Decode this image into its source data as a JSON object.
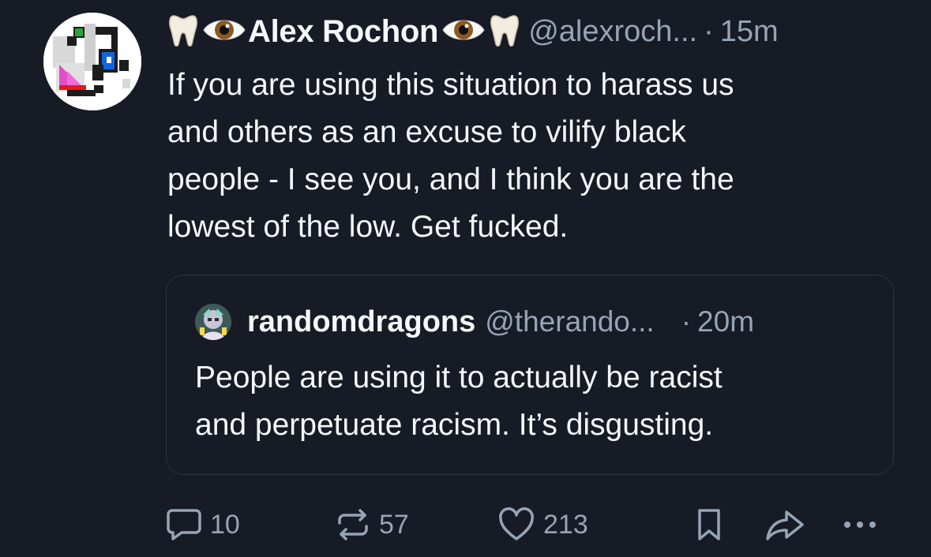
{
  "post": {
    "author": {
      "name_prefix_emoji": [
        "tooth",
        "eye"
      ],
      "display_name": "Alex Rochon",
      "name_suffix_emoji": [
        "eye",
        "tooth"
      ],
      "handle": "@alexroch...",
      "separator": "·",
      "time": "15m"
    },
    "text_lines": [
      "If you are using this situation to harass us",
      "and others as an excuse to vilify black",
      "people - I see you, and I think you are the",
      "lowest of the low. Get fucked."
    ],
    "quote": {
      "display_name": "randomdragons",
      "handle": "@therando...",
      "separator": "·",
      "time": "20m",
      "text_lines": [
        "People are using it to actually be racist",
        "and perpetuate racism. It’s disgusting."
      ]
    },
    "actions": {
      "reply_count": "10",
      "repost_count": "57",
      "like_count": "213"
    }
  },
  "colors": {
    "background": "#161b25",
    "text_primary": "#f5f7fa",
    "text_secondary": "#97a3b6",
    "border": "#2c3544"
  },
  "icons": {
    "reply": "speech-bubble-icon",
    "repost": "repost-arrows-icon",
    "like": "heart-icon",
    "bookmark": "bookmark-icon",
    "share": "share-arrow-icon",
    "more": "ellipsis-icon"
  }
}
